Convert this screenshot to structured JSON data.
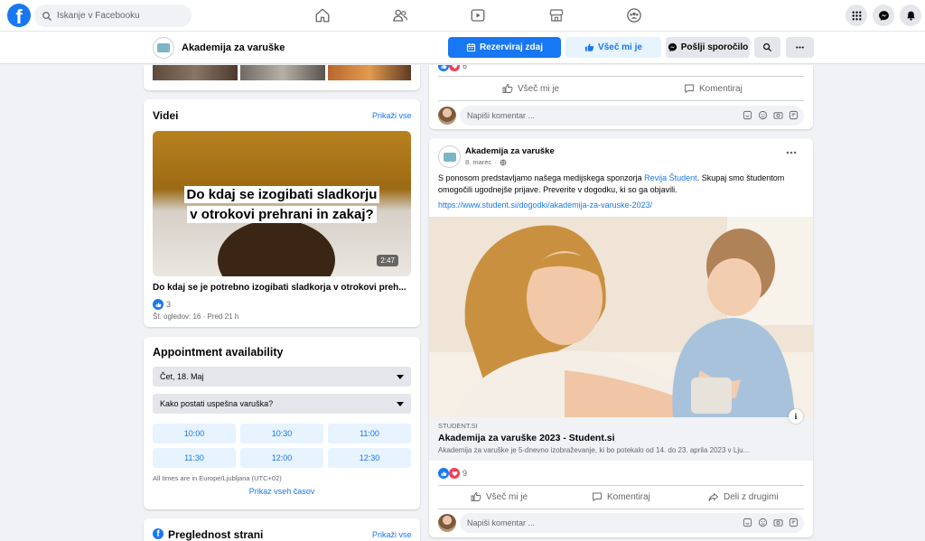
{
  "topbar": {
    "search_placeholder": "Iskanje v Facebooku",
    "logo_letter": "f"
  },
  "page": {
    "name": "Akademija za varuške",
    "buttons": {
      "book": "Rezerviraj zdaj",
      "like": "Všeč mi je",
      "message": "Pošlji sporočilo"
    }
  },
  "videos": {
    "title": "Videi",
    "see_all": "Prikaži vse",
    "video": {
      "caption": "Do kdaj se izogibati sladkorju v otrokovi prehrani in zakaj?",
      "duration": "2:47",
      "title": "Do kdaj se je potrebno izogibati sladkorja v otrokovi preh...",
      "likes": "3",
      "meta": "Št. ogledov: 16 · Pred 21 h"
    }
  },
  "appointment": {
    "title": "Appointment availability",
    "date": "Čet, 18. Maj",
    "service": "Kako postati uspešna varuška?",
    "slots": [
      "10:00",
      "10:30",
      "11:00",
      "11:30",
      "12:00",
      "12:30"
    ],
    "timezone": "All times are in Europe/Ljubljana (UTC+02)",
    "show_all": "Prikaz vseh časov"
  },
  "overview": {
    "title": "Preglednost strani",
    "see_all": "Prikaži vse"
  },
  "post1": {
    "reaction_count": "6",
    "like": "Všeč mi je",
    "comment": "Komentiraj",
    "comment_placeholder": "Napiši komentar ..."
  },
  "post2": {
    "author": "Akademija za varuške",
    "date": "8. marec",
    "text_before": "S ponosom predstavljamo našega medijskega sponzorja ",
    "text_link": "Revija Študent",
    "text_after": ". Skupaj smo študentom omogočili ugodnejše prijave. Preverite v dogodku, ki so ga objavili.",
    "url": "https://www.student.si/dogodki/akademija-za-varuske-2023/",
    "link_domain": "STUDENT.SI",
    "link_title": "Akademija za varuške 2023 - Student.si",
    "link_desc": "Akademija za varuške je 5-dnevno izobraževanje, ki bo potekalo od 14. do 23. aprila 2023 v Lju...",
    "reaction_count": "9",
    "like": "Všeč mi je",
    "comment": "Komentiraj",
    "share": "Deli z drugimi",
    "comment_placeholder": "Napiši komentar ..."
  },
  "colors": {
    "brand": "#1877f2",
    "like_blue": "#1877f2",
    "love_red": "#f33e58"
  }
}
